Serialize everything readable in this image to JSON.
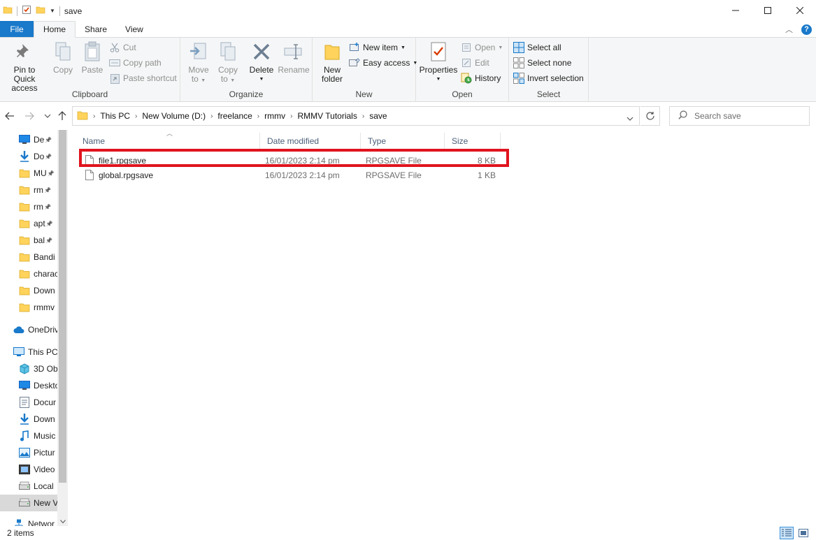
{
  "window": {
    "title": "save"
  },
  "tabs": [
    {
      "label": "File"
    },
    {
      "label": "Home"
    },
    {
      "label": "Share"
    },
    {
      "label": "View"
    }
  ],
  "ribbon": {
    "clipboard": {
      "label": "Clipboard",
      "pin_line1": "Pin to Quick",
      "pin_line2": "access",
      "copy": "Copy",
      "paste": "Paste",
      "cut": "Cut",
      "copy_path": "Copy path",
      "paste_shortcut": "Paste shortcut"
    },
    "organize": {
      "label": "Organize",
      "move_to_line1": "Move",
      "move_to_line2": "to",
      "copy_to_line1": "Copy",
      "copy_to_line2": "to",
      "delete": "Delete",
      "rename": "Rename"
    },
    "new": {
      "label": "New",
      "new_folder_line1": "New",
      "new_folder_line2": "folder",
      "new_item": "New item",
      "easy_access": "Easy access"
    },
    "open": {
      "label": "Open",
      "properties": "Properties",
      "open": "Open",
      "edit": "Edit",
      "history": "History"
    },
    "select": {
      "label": "Select",
      "select_all": "Select all",
      "select_none": "Select none",
      "invert_selection": "Invert selection"
    }
  },
  "address": {
    "crumbs": [
      "This PC",
      "New Volume (D:)",
      "freelance",
      "rmmv",
      "RMMV Tutorials",
      "save"
    ]
  },
  "search": {
    "placeholder": "Search save"
  },
  "nav_pane": {
    "items": [
      {
        "label": "De",
        "icon": "desktop-icon",
        "pinned": true
      },
      {
        "label": "Do",
        "icon": "download-icon",
        "pinned": true
      },
      {
        "label": "MU",
        "icon": "folder-icon",
        "pinned": true
      },
      {
        "label": "rm",
        "icon": "folder-icon",
        "pinned": true
      },
      {
        "label": "rm",
        "icon": "folder-icon",
        "pinned": true
      },
      {
        "label": "apt",
        "icon": "folder-icon",
        "pinned": true
      },
      {
        "label": "bal",
        "icon": "folder-icon",
        "pinned": true
      },
      {
        "label": "Bandi",
        "icon": "folder-icon",
        "pinned": false
      },
      {
        "label": "charac",
        "icon": "folder-icon",
        "pinned": false
      },
      {
        "label": "Down",
        "icon": "folder-icon",
        "pinned": false
      },
      {
        "label": "rmmv",
        "icon": "folder-icon",
        "pinned": false
      },
      {
        "label": "OneDriv",
        "icon": "cloud-icon",
        "pinned": false
      },
      {
        "label": "This PC",
        "icon": "computer-icon",
        "pinned": false
      },
      {
        "label": "3D Ob",
        "icon": "cube-icon",
        "pinned": false
      },
      {
        "label": "Deskto",
        "icon": "desktop-icon",
        "pinned": false
      },
      {
        "label": "Docur",
        "icon": "document-icon",
        "pinned": false
      },
      {
        "label": "Down",
        "icon": "download-icon",
        "pinned": false
      },
      {
        "label": "Music",
        "icon": "music-icon",
        "pinned": false
      },
      {
        "label": "Pictur",
        "icon": "picture-icon",
        "pinned": false
      },
      {
        "label": "Video",
        "icon": "video-icon",
        "pinned": false
      },
      {
        "label": "Local",
        "icon": "drive-icon",
        "pinned": false
      },
      {
        "label": "New V",
        "icon": "drive-icon",
        "pinned": false
      },
      {
        "label": "Networ",
        "icon": "network-icon",
        "pinned": false
      }
    ]
  },
  "file_list": {
    "columns": {
      "name": "Name",
      "date": "Date modified",
      "type": "Type",
      "size": "Size"
    },
    "rows": [
      {
        "name": "file1.rpgsave",
        "date": "16/01/2023 2:14 pm",
        "type": "RPGSAVE File",
        "size": "8 KB"
      },
      {
        "name": "global.rpgsave",
        "date": "16/01/2023 2:14 pm",
        "type": "RPGSAVE File",
        "size": "1 KB"
      }
    ]
  },
  "status": {
    "count": "2 items"
  },
  "colors": {
    "accent": "#1979ca",
    "highlight": "#e0141e",
    "folder": "#ffd35c"
  }
}
